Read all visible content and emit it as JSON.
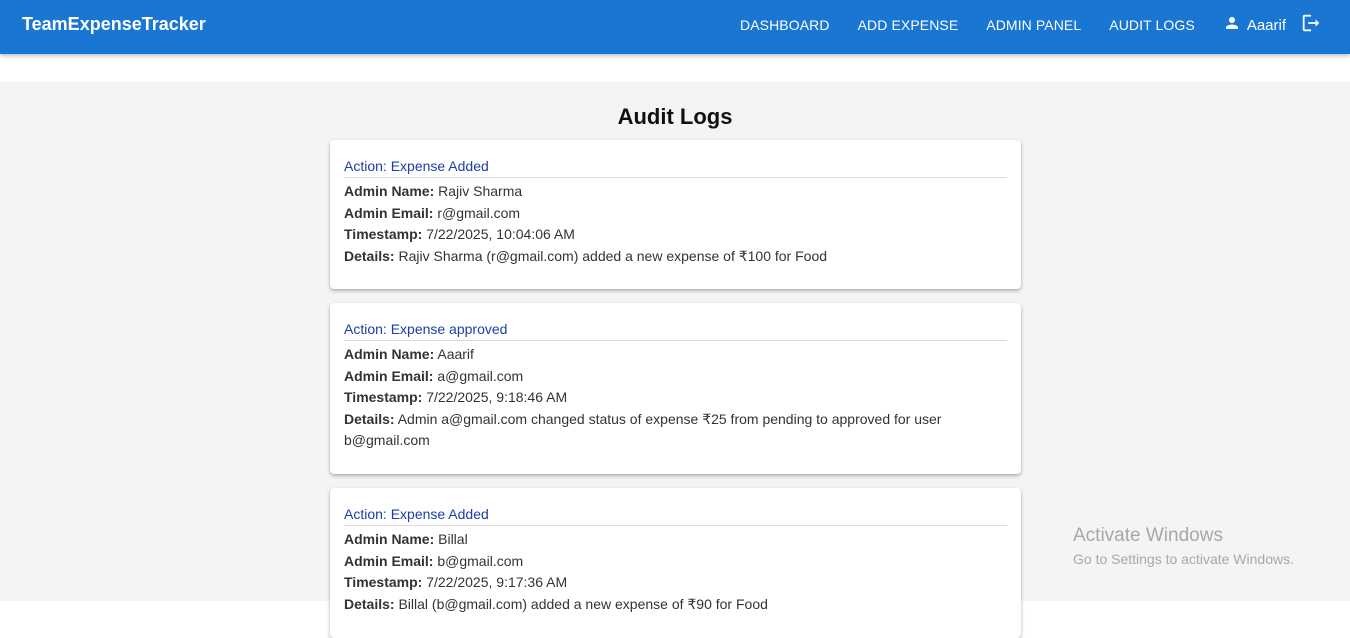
{
  "app": {
    "brand": "TeamExpenseTracker"
  },
  "nav": {
    "items": [
      {
        "label": "DASHBOARD"
      },
      {
        "label": "ADD EXPENSE"
      },
      {
        "label": "ADMIN PANEL"
      },
      {
        "label": "AUDIT LOGS"
      }
    ],
    "user_name": "Aaarif",
    "icons": {
      "user": "person-icon",
      "logout": "logout-icon"
    }
  },
  "page": {
    "title": "Audit Logs"
  },
  "labels": {
    "admin_name": "Admin Name:",
    "admin_email": "Admin Email:",
    "timestamp": "Timestamp:",
    "details": "Details:"
  },
  "logs": [
    {
      "action": "Action: Expense Added",
      "admin_name": "Rajiv Sharma",
      "admin_email": "r@gmail.com",
      "timestamp": "7/22/2025, 10:04:06 AM",
      "details": "Rajiv Sharma (r@gmail.com) added a new expense of ₹100 for Food"
    },
    {
      "action": "Action: Expense approved",
      "admin_name": "Aaarif",
      "admin_email": "a@gmail.com",
      "timestamp": "7/22/2025, 9:18:46 AM",
      "details": "Admin a@gmail.com changed status of expense ₹25 from pending to approved for user b@gmail.com"
    },
    {
      "action": "Action: Expense Added",
      "admin_name": "Billal",
      "admin_email": "b@gmail.com",
      "timestamp": "7/22/2025, 9:17:36 AM",
      "details": "Billal (b@gmail.com) added a new expense of ₹90 for Food"
    }
  ],
  "watermark": {
    "title": "Activate Windows",
    "subtitle": "Go to Settings to activate Windows."
  },
  "colors": {
    "appbar": "#1976d2",
    "action_text": "#1a3fa6",
    "page_bg": "#f3f4f6"
  }
}
